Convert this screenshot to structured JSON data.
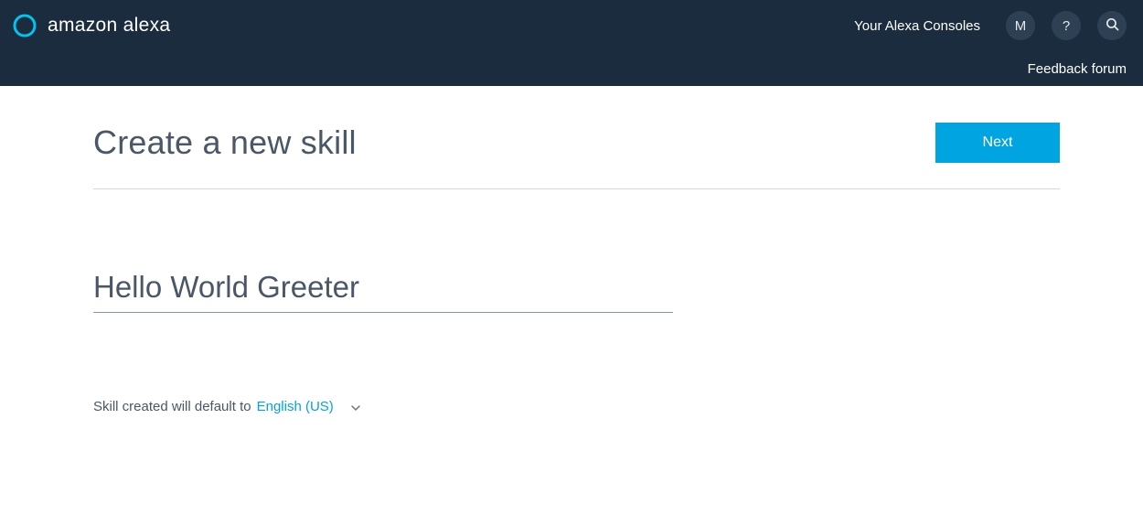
{
  "header": {
    "logo_text": "amazon alexa",
    "consoles_label": "Your Alexa Consoles",
    "avatar_letter": "M",
    "feedback_label": "Feedback forum"
  },
  "page": {
    "title": "Create a new skill",
    "next_button": "Next"
  },
  "skill": {
    "name_value": "Hello World Greeter"
  },
  "language": {
    "prefix_label": "Skill created will default to",
    "selected": "English (US)"
  }
}
